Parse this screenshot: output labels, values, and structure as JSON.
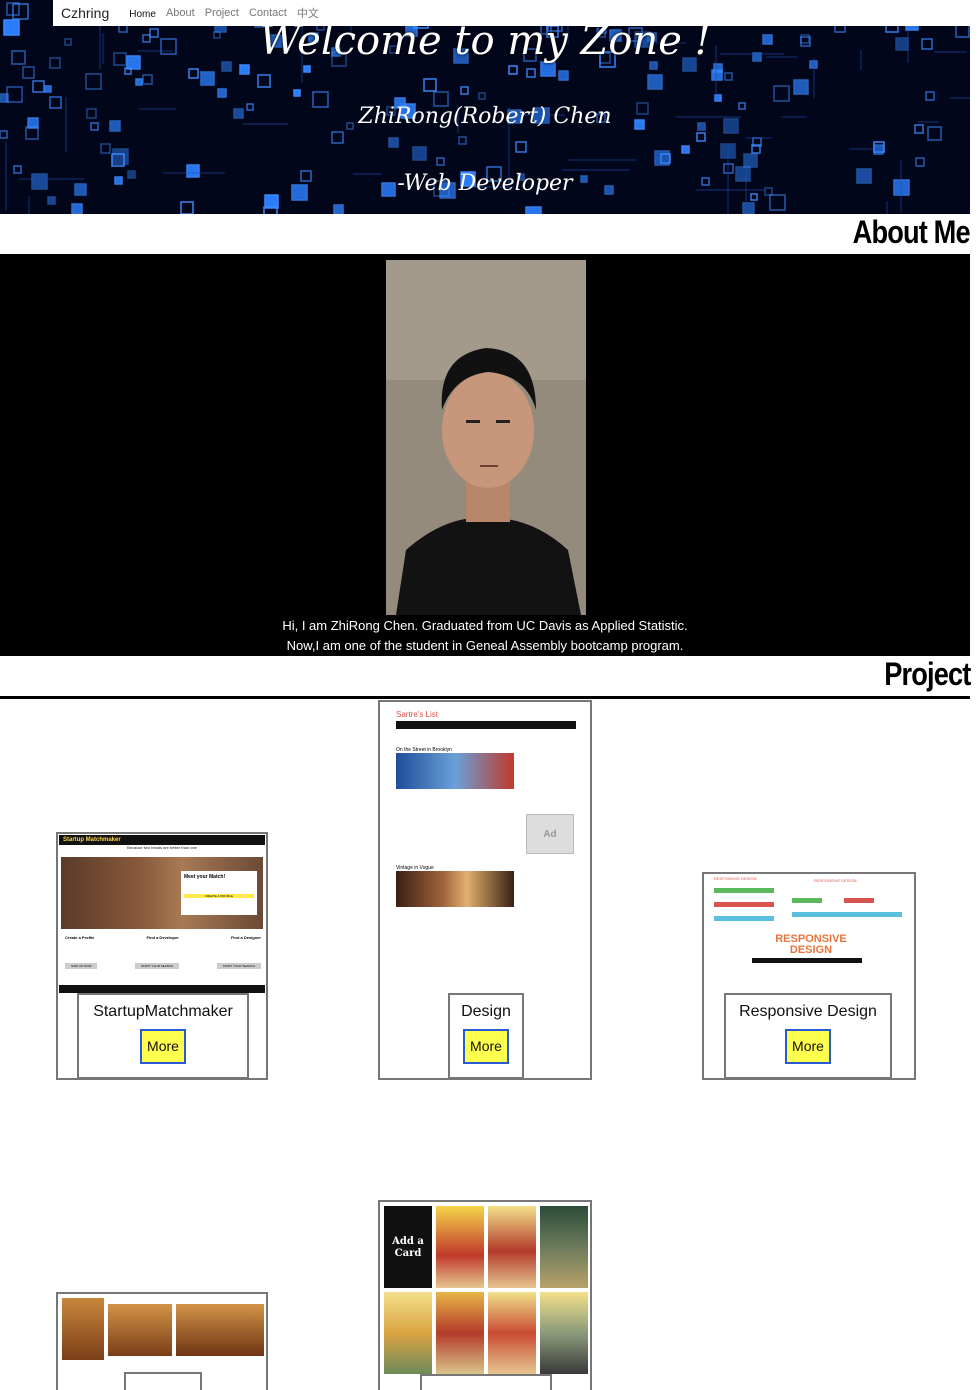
{
  "nav": {
    "brand": "Czhring",
    "links": [
      "Home",
      "About",
      "Project",
      "Contact",
      "中文"
    ]
  },
  "hero": {
    "title": "Welcome to my Zone !",
    "name": "ZhiRong(Robert) Chen",
    "role": "-Web Developer"
  },
  "about": {
    "heading": "About Me",
    "line1": "Hi, I am ZhiRong Chen. Graduated from UC Davis as Applied Statistic.",
    "line2": "Now,I am one of the student in Geneal Assembly bootcamp program."
  },
  "project": {
    "heading": "Project",
    "cards": [
      {
        "title": "StartupMatchmaker",
        "button": "More"
      },
      {
        "title": "Design",
        "button": "More"
      },
      {
        "title": "Responsive Design",
        "button": "More"
      }
    ]
  },
  "thumbs": {
    "startup": {
      "brand": "Startup Matchmaker",
      "headline": "Because two heads are better than one",
      "meet": "Meet your Match!",
      "cta": "CREATE A PROFILE",
      "col1": "Create a Profile",
      "col2": "Find a Developer",
      "col3": "Find a Designer",
      "btn1": "SIGN UP NOW",
      "btn2": "START YOUR SEARCH",
      "btn3": "START YOUR SEARCH"
    },
    "sartre": {
      "title": "Sartre's List",
      "post1": "On the Street in Brooklyn",
      "post2": "Vintage in Vogue",
      "ad": "Ad"
    },
    "responsive": {
      "title1": "RESPONSIVE DESIGN",
      "title2": "RESPONSIVE DESIGN",
      "big": "RESPONSIVE DESIGN"
    },
    "cards": {
      "add": "Add a Card"
    }
  },
  "colors": {
    "hero_bg": "#02061a",
    "accent_blue": "#2a5bd7",
    "button_yellow": "#ffff4d"
  }
}
